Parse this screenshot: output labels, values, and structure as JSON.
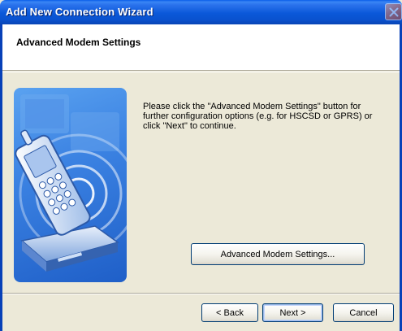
{
  "window": {
    "title": "Add New Connection Wizard"
  },
  "header": {
    "title": "Advanced Modem Settings"
  },
  "content": {
    "instructions": "Please click the \"Advanced Modem Settings\" button for further configuration options (e.g. for HSCSD or GPRS) or click \"Next\" to continue.",
    "advanced_button_label": "Advanced Modem Settings..."
  },
  "footer": {
    "back_label": "< Back",
    "next_label": "Next >",
    "cancel_label": "Cancel"
  },
  "icons": {
    "close": "close-icon",
    "illustration": "mobile-phone-modem-illustration"
  },
  "colors": {
    "titlebar": "#0a52cf",
    "dialog_bg": "#ece9d8",
    "header_bg": "#ffffff",
    "button_border": "#003c74"
  }
}
